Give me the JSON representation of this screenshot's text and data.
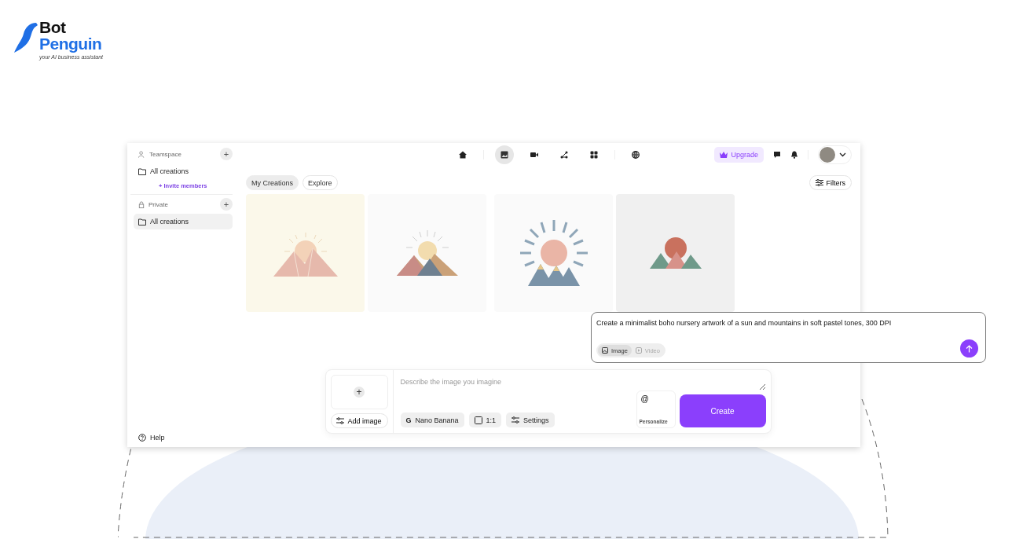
{
  "brand": {
    "name_top": "Bot",
    "name_bottom": "Penguin",
    "tagline": "your AI business assistant"
  },
  "sidebar": {
    "sections": [
      {
        "title": "Teamspace",
        "kind": "team",
        "add": "+",
        "items": [
          {
            "label": "All creations",
            "selected": false
          }
        ],
        "invite": {
          "icon": "+",
          "label": "Invite members"
        }
      },
      {
        "title": "Private",
        "kind": "private",
        "add": "+",
        "items": [
          {
            "label": "All creations",
            "selected": true
          }
        ]
      }
    ],
    "help": "Help"
  },
  "topbar": {
    "nav": [
      {
        "kind": "home",
        "selected": false
      },
      {
        "kind": "image",
        "selected": true
      },
      {
        "kind": "video",
        "selected": false
      },
      {
        "kind": "flow",
        "selected": false
      },
      {
        "kind": "apps",
        "selected": false
      },
      {
        "kind": "globe",
        "selected": false
      }
    ],
    "upgrade": "Upgrade"
  },
  "tabs": [
    {
      "label": "My Creations",
      "selected": true
    },
    {
      "label": "Explore",
      "selected": false
    }
  ],
  "filters": "Filters",
  "composer": {
    "add_icon": "+",
    "add_image": "Add image",
    "placeholder": "Describe the image you imagine",
    "chips": [
      {
        "kind": "model",
        "glyph": "G",
        "label": "Nano Banana"
      },
      {
        "kind": "ratio",
        "label": "1:1"
      },
      {
        "kind": "settings",
        "label": "Settings"
      }
    ],
    "personalize_icon": "@",
    "personalize": "Personalize",
    "create": "Create"
  },
  "prompt_card": {
    "value": "Create a minimalist boho nursery artwork of a sun and mountains in soft pastel tones, 300 DPI",
    "modes": [
      {
        "kind": "image",
        "label": "Image",
        "selected": true
      },
      {
        "kind": "video",
        "label": "Video",
        "selected": false
      }
    ]
  }
}
